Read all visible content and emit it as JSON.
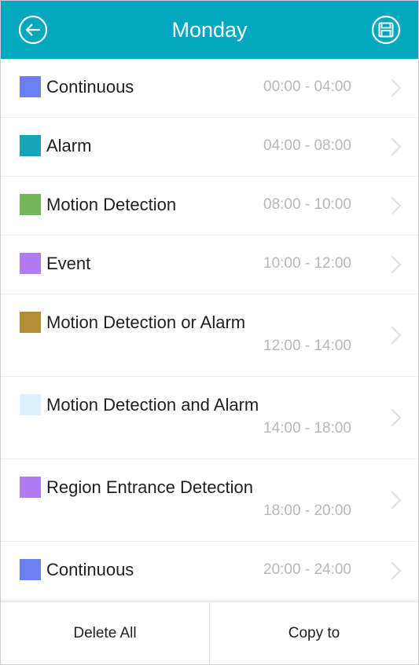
{
  "header": {
    "title": "Monday",
    "back_icon": "arrow-left-circle-icon",
    "save_icon": "floppy-disk-circle-icon"
  },
  "schedule": [
    {
      "label": "Continuous",
      "time": "00:00 - 04:00",
      "color": "#6b7ff2",
      "layout": "single"
    },
    {
      "label": "Alarm",
      "time": "04:00 - 08:00",
      "color": "#17a4b7",
      "layout": "single"
    },
    {
      "label": "Motion Detection",
      "time": "08:00 - 10:00",
      "color": "#72b85a",
      "layout": "single"
    },
    {
      "label": "Event",
      "time": "10:00 - 12:00",
      "color": "#b27bf2",
      "layout": "single"
    },
    {
      "label": "Motion Detection or Alarm",
      "time": "12:00 - 14:00",
      "color": "#b28f30",
      "layout": "double"
    },
    {
      "label": "Motion Detection and Alarm",
      "time": "14:00 - 18:00",
      "color": "#dff0fd",
      "layout": "double"
    },
    {
      "label": "Region Entrance Detection",
      "time": "18:00 - 20:00",
      "color": "#b27bf2",
      "layout": "double"
    },
    {
      "label": "Continuous",
      "time": "20:00 - 24:00",
      "color": "#6b7ff2",
      "layout": "single"
    }
  ],
  "footer": {
    "delete_all_label": "Delete All",
    "copy_to_label": "Copy to"
  },
  "colors": {
    "header_bg": "#03a8be",
    "time_text": "#b8b8b8",
    "chevron": "#e0e0e0"
  }
}
